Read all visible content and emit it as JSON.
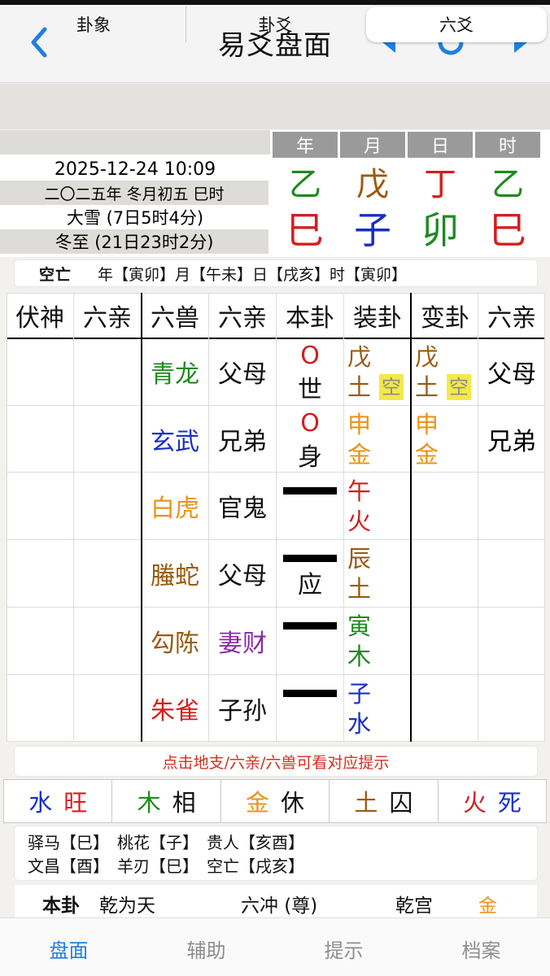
{
  "nav": {
    "title": "易爻盘面",
    "back_icon": "chevron-left-icon",
    "prev_icon": "triangle-left-icon",
    "refresh_icon": "refresh-icon",
    "next_icon": "triangle-right-icon",
    "accent": "#1f7fe0"
  },
  "tabs": [
    {
      "label": "卦象",
      "selected": false
    },
    {
      "label": "卦爻",
      "selected": false
    },
    {
      "label": "六爻",
      "selected": true
    }
  ],
  "date": {
    "datetime": "2025-12-24 10:09",
    "lunar": "二〇二五年 冬月初五 巳时",
    "term1": "大雪 (7日5时4分)",
    "term2": "冬至 (21日23时2分)"
  },
  "ganzhi": {
    "headers": [
      "年",
      "月",
      "日",
      "时"
    ],
    "stems": [
      {
        "char": "乙",
        "color": "#1e8a1e"
      },
      {
        "char": "戊",
        "color": "#9a5a10"
      },
      {
        "char": "丁",
        "color": "#d21f1f"
      },
      {
        "char": "乙",
        "color": "#1e8a1e"
      }
    ],
    "branches": [
      {
        "char": "巳",
        "color": "#d21f1f"
      },
      {
        "char": "子",
        "color": "#1a2fc4"
      },
      {
        "char": "卯",
        "color": "#1e8a1e"
      },
      {
        "char": "巳",
        "color": "#d21f1f"
      }
    ]
  },
  "void": {
    "label": "空亡",
    "text": "年【寅卯】月【午未】日【戌亥】时【寅卯】"
  },
  "table": {
    "headers": [
      "伏神",
      "六亲",
      "六兽",
      "六亲",
      "本卦",
      "装卦",
      "变卦",
      "六亲"
    ],
    "rows": [
      {
        "fushen": "",
        "qin1": "",
        "beast": "青龙",
        "beast_color": "#1e8a1e",
        "qin2": "父母",
        "qin2_color": "#111111",
        "yao_mark": "O",
        "yao_label": "世",
        "yao_broken": false,
        "zhuang": [
          "戊",
          "土"
        ],
        "zhuang_color": "#9a5a10",
        "zhuang_kong": "空",
        "bian": [
          "戊",
          "土"
        ],
        "bian_color": "#9a5a10",
        "bian_kong": "空",
        "qin3": "父母"
      },
      {
        "fushen": "",
        "qin1": "",
        "beast": "玄武",
        "beast_color": "#1a2fc4",
        "qin2": "兄弟",
        "qin2_color": "#111111",
        "yao_mark": "O",
        "yao_label": "身",
        "yao_broken": false,
        "zhuang": [
          "申",
          "金"
        ],
        "zhuang_color": "#e8941a",
        "zhuang_kong": "",
        "bian": [
          "申",
          "金"
        ],
        "bian_color": "#e8941a",
        "bian_kong": "",
        "qin3": "兄弟"
      },
      {
        "fushen": "",
        "qin1": "",
        "beast": "白虎",
        "beast_color": "#e8941a",
        "qin2": "官鬼",
        "qin2_color": "#111111",
        "yao_mark": "",
        "yao_label": "",
        "yao_broken": false,
        "zhuang": [
          "午",
          "火"
        ],
        "zhuang_color": "#d21f1f",
        "zhuang_kong": "",
        "bian": [
          "",
          ""
        ],
        "bian_color": "#111111",
        "bian_kong": "",
        "qin3": ""
      },
      {
        "fushen": "",
        "qin1": "",
        "beast": "螣蛇",
        "beast_color": "#9a5a10",
        "qin2": "父母",
        "qin2_color": "#111111",
        "yao_mark": "",
        "yao_label": "应",
        "yao_broken": false,
        "zhuang": [
          "辰",
          "土"
        ],
        "zhuang_color": "#9a5a10",
        "zhuang_kong": "",
        "bian": [
          "",
          ""
        ],
        "bian_color": "#111111",
        "bian_kong": "",
        "qin3": ""
      },
      {
        "fushen": "",
        "qin1": "",
        "beast": "勾陈",
        "beast_color": "#9a5a10",
        "qin2": "妻财",
        "qin2_color": "#8a2aa8",
        "yao_mark": "",
        "yao_label": "",
        "yao_broken": false,
        "zhuang": [
          "寅",
          "木"
        ],
        "zhuang_color": "#1e8a1e",
        "zhuang_kong": "",
        "bian": [
          "",
          ""
        ],
        "bian_color": "#111111",
        "bian_kong": "",
        "qin3": ""
      },
      {
        "fushen": "",
        "qin1": "",
        "beast": "朱雀",
        "beast_color": "#d21f1f",
        "qin2": "子孙",
        "qin2_color": "#111111",
        "yao_mark": "",
        "yao_label": "",
        "yao_broken": false,
        "zhuang": [
          "子",
          "水"
        ],
        "zhuang_color": "#1a2fc4",
        "zhuang_kong": "",
        "bian": [
          "",
          ""
        ],
        "bian_color": "#111111",
        "bian_kong": "",
        "qin3": ""
      }
    ]
  },
  "hint": "点击地支/六亲/六兽可看对应提示",
  "seasons": [
    {
      "elem": "水",
      "elem_color": "#1a2fc4",
      "state": "旺",
      "state_color": "#d21f1f"
    },
    {
      "elem": "木",
      "elem_color": "#1e8a1e",
      "state": "相",
      "state_color": "#111111"
    },
    {
      "elem": "金",
      "elem_color": "#e8941a",
      "state": "休",
      "state_color": "#111111"
    },
    {
      "elem": "土",
      "elem_color": "#9a5a10",
      "state": "囚",
      "state_color": "#111111"
    },
    {
      "elem": "火",
      "elem_color": "#d21f1f",
      "state": "死",
      "state_color": "#1a2fc4"
    }
  ],
  "shensha": {
    "line1": [
      "驿马【巳】",
      "桃花【子】",
      "贵人【亥酉】"
    ],
    "line2": [
      "文昌【酉】",
      "羊刃【巳】",
      "空亡【戌亥】"
    ]
  },
  "gua": {
    "label": "本卦",
    "name": "乾为天",
    "type": "六冲 (尊)",
    "palace": "乾宫",
    "element": "金",
    "element_color": "#e8941a"
  },
  "tabbar": [
    {
      "label": "盘面",
      "active": true
    },
    {
      "label": "辅助",
      "active": false
    },
    {
      "label": "提示",
      "active": false
    },
    {
      "label": "档案",
      "active": false
    }
  ]
}
